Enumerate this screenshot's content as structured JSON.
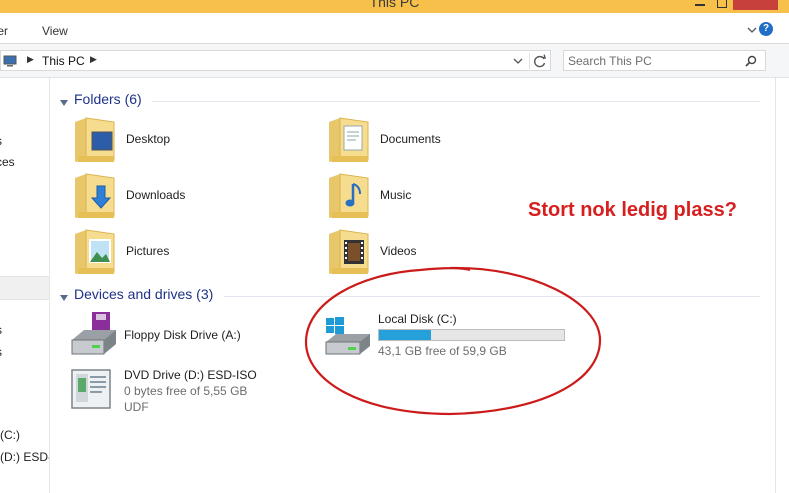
{
  "window": {
    "title": "This PC"
  },
  "ribbon": {
    "tabs": [
      "ter",
      "View"
    ]
  },
  "address": {
    "crumb": "This PC"
  },
  "search": {
    "placeholder": "Search This PC"
  },
  "nav": {
    "items": [
      "s",
      "ces",
      "s",
      "s",
      "(C:)",
      "(D:) ESD-I"
    ]
  },
  "folders": {
    "header": "Folders (6)",
    "items": [
      {
        "label": "Desktop",
        "icon": "desktop-folder-icon"
      },
      {
        "label": "Documents",
        "icon": "documents-folder-icon"
      },
      {
        "label": "Downloads",
        "icon": "downloads-folder-icon"
      },
      {
        "label": "Music",
        "icon": "music-folder-icon"
      },
      {
        "label": "Pictures",
        "icon": "pictures-folder-icon"
      },
      {
        "label": "Videos",
        "icon": "videos-folder-icon"
      }
    ]
  },
  "drives": {
    "header": "Devices and drives (3)",
    "items": [
      {
        "name": "Floppy Disk Drive (A:)",
        "icon": "floppy-drive-icon"
      },
      {
        "name": "Local Disk (C:)",
        "free": "43,1 GB free of 59,9 GB",
        "used_fraction": 0.28,
        "icon": "local-disk-icon"
      },
      {
        "name": "DVD Drive (D:) ESD-ISO",
        "free": "0 bytes free of 5,55 GB",
        "fs": "UDF",
        "icon": "dvd-drive-icon"
      }
    ]
  },
  "annotation": {
    "text": "Stort nok ledig plass?",
    "color": "#d81f1f"
  },
  "colors": {
    "title_bar": "#f6c04b",
    "close_button": "#c7403b",
    "progress": "#26a0da",
    "group_header": "#1e3287"
  }
}
